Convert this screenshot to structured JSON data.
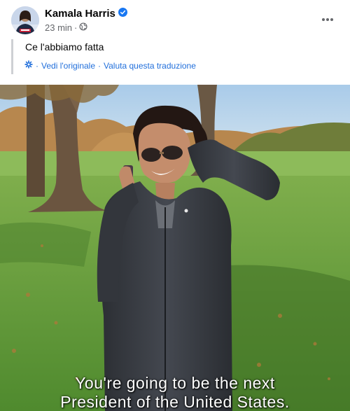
{
  "post": {
    "author": "Kamala Harris",
    "time": "23 min",
    "separator": "·",
    "text": "Ce l'abbiamo fatta",
    "see_original": "Vedi l'originale",
    "rate_translation": "Valuta questa traduzione",
    "translate_separator": "·"
  },
  "video": {
    "subtitle_line1": "You're going to be the next",
    "subtitle_line2": "President of the United States."
  },
  "colors": {
    "link": "#216fdb",
    "verified": "#1877f2",
    "secondary_text": "#65676b"
  },
  "icons": {
    "verified": "verified-badge-icon",
    "audience": "globe-icon",
    "more": "more-options-icon",
    "translate": "gear-icon"
  }
}
